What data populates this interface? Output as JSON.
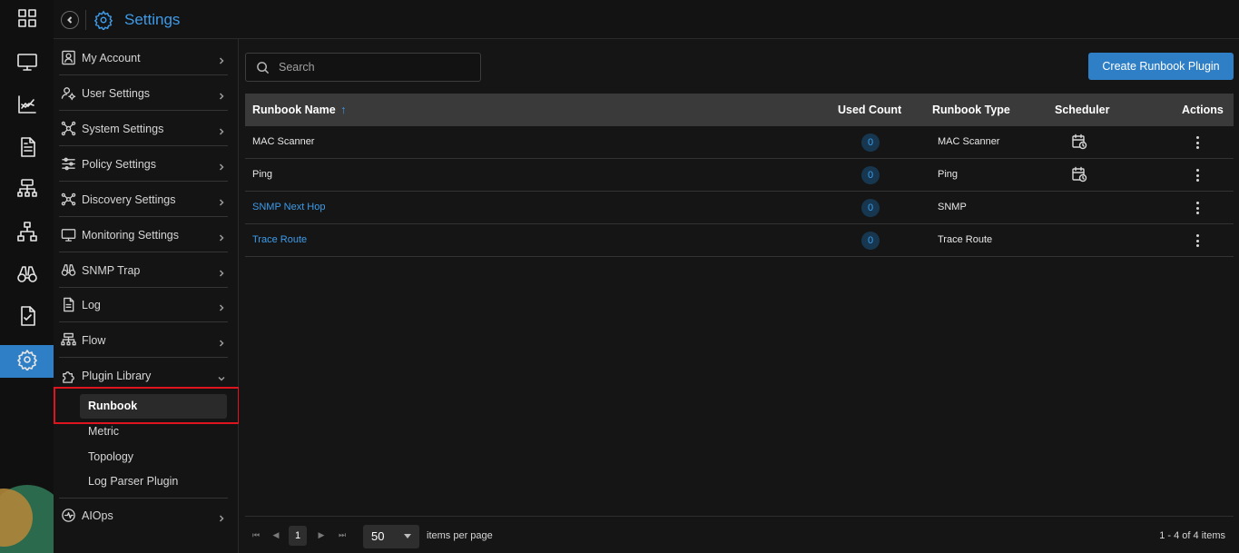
{
  "header": {
    "title": "Settings"
  },
  "rail": {
    "items": [
      {
        "icon": "grid-icon"
      },
      {
        "icon": "monitor-icon"
      },
      {
        "icon": "chart-icon"
      },
      {
        "icon": "document-icon"
      },
      {
        "icon": "network-flow-icon"
      },
      {
        "icon": "topology-icon"
      },
      {
        "icon": "binoculars-icon"
      },
      {
        "icon": "checklist-icon"
      },
      {
        "icon": "gear-icon",
        "active": true
      }
    ]
  },
  "nav": {
    "items": [
      {
        "label": "My Account",
        "icon": "user-icon"
      },
      {
        "label": "User Settings",
        "icon": "user-gear-icon"
      },
      {
        "label": "System Settings",
        "icon": "system-icon"
      },
      {
        "label": "Policy Settings",
        "icon": "sliders-icon"
      },
      {
        "label": "Discovery Settings",
        "icon": "discovery-icon"
      },
      {
        "label": "Monitoring Settings",
        "icon": "monitor-icon"
      },
      {
        "label": "SNMP Trap",
        "icon": "binoculars-icon"
      },
      {
        "label": "Log",
        "icon": "log-icon"
      },
      {
        "label": "Flow",
        "icon": "flow-icon"
      },
      {
        "label": "Plugin Library",
        "icon": "puzzle-icon",
        "expanded": true
      },
      {
        "label": "AIOps",
        "icon": "aiops-icon"
      }
    ],
    "plugin_sub": [
      "Runbook",
      "Metric",
      "Topology",
      "Log Parser Plugin"
    ],
    "active_sub": "Runbook"
  },
  "main": {
    "search_placeholder": "Search",
    "create_button": "Create Runbook Plugin",
    "columns": {
      "name": "Runbook Name",
      "sort_indicator": "↑",
      "used_count": "Used Count",
      "type": "Runbook Type",
      "scheduler": "Scheduler",
      "actions": "Actions"
    },
    "rows": [
      {
        "name": "MAC Scanner",
        "used_count": "0",
        "type": "MAC Scanner",
        "scheduler": true,
        "link": false
      },
      {
        "name": "Ping",
        "used_count": "0",
        "type": "Ping",
        "scheduler": true,
        "link": false
      },
      {
        "name": "SNMP Next Hop",
        "used_count": "0",
        "type": "SNMP",
        "scheduler": false,
        "link": true
      },
      {
        "name": "Trace Route",
        "used_count": "0",
        "type": "Trace Route",
        "scheduler": false,
        "link": true
      }
    ]
  },
  "pager": {
    "current_page": "1",
    "page_size": "50",
    "per_page_label": "items per page",
    "info": "1 - 4 of 4 items"
  },
  "colors": {
    "accent": "#2f7fc6",
    "link": "#3d9be9",
    "highlight": "#e0141e"
  }
}
